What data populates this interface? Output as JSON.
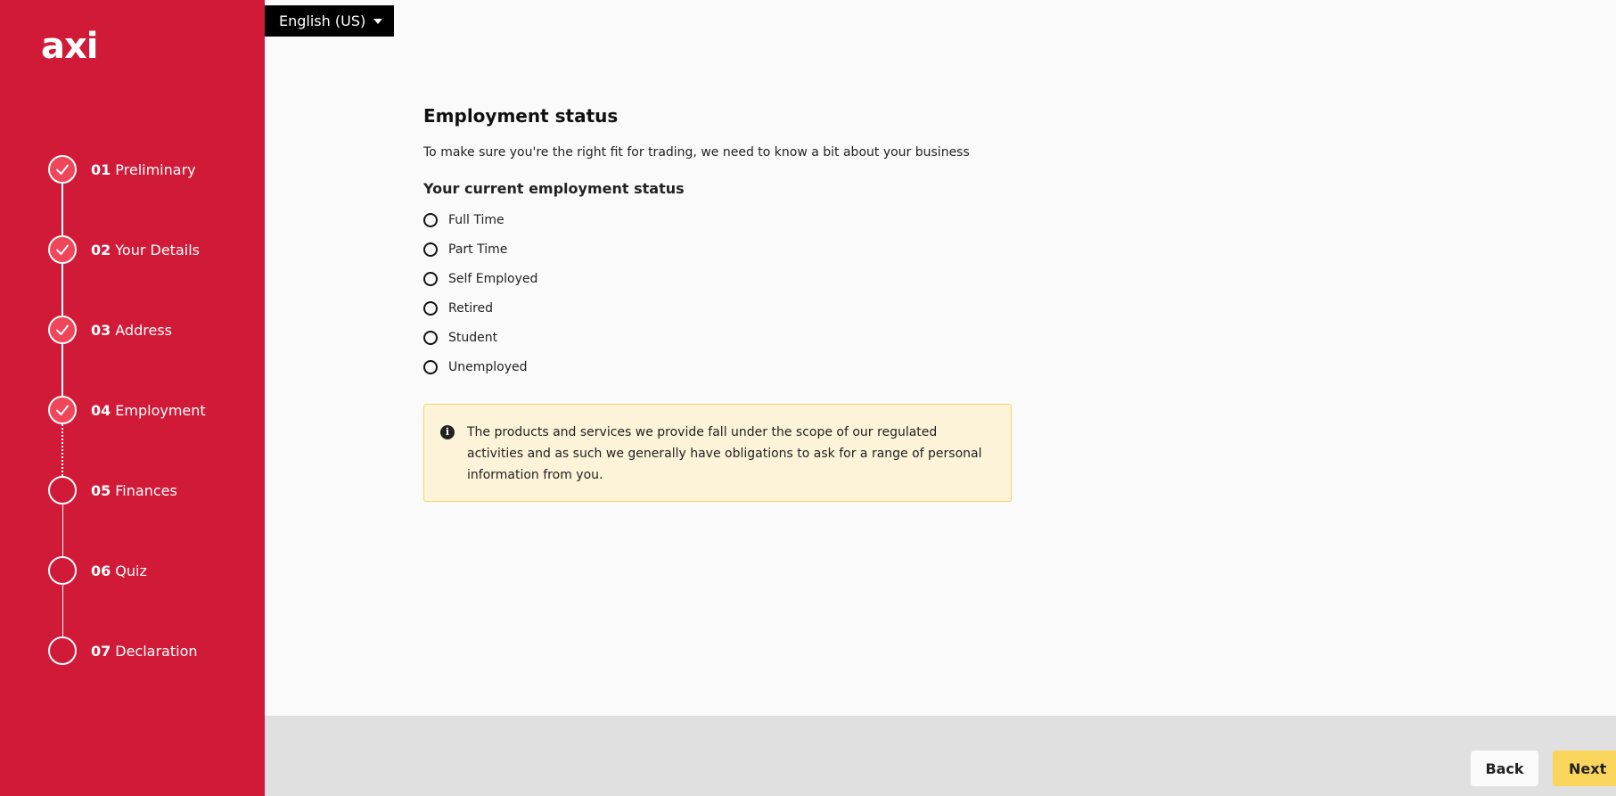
{
  "brand": {
    "logo": "axi",
    "primary_color": "#d11a37",
    "accent_color": "#fad55c"
  },
  "language": {
    "selected": "English (US)"
  },
  "steps": [
    {
      "number": "01",
      "label": "Preliminary",
      "status": "done"
    },
    {
      "number": "02",
      "label": "Your Details",
      "status": "done"
    },
    {
      "number": "03",
      "label": "Address",
      "status": "done"
    },
    {
      "number": "04",
      "label": "Employment",
      "status": "done"
    },
    {
      "number": "05",
      "label": "Finances",
      "status": "pending"
    },
    {
      "number": "06",
      "label": "Quiz",
      "status": "pending"
    },
    {
      "number": "07",
      "label": "Declaration",
      "status": "pending"
    }
  ],
  "main": {
    "title": "Employment status",
    "subtitle": "To make sure you're the right fit for trading, we need to know a bit about your business",
    "question": "Your current employment status",
    "options": [
      "Full Time",
      "Part Time",
      "Self Employed",
      "Retired",
      "Student",
      "Unemployed"
    ],
    "notice": "The products and services we provide fall under the scope of our regulated activities and as such we generally have obligations to ask for a range of personal information from you."
  },
  "footer": {
    "back_label": "Back",
    "next_label": "Next"
  }
}
